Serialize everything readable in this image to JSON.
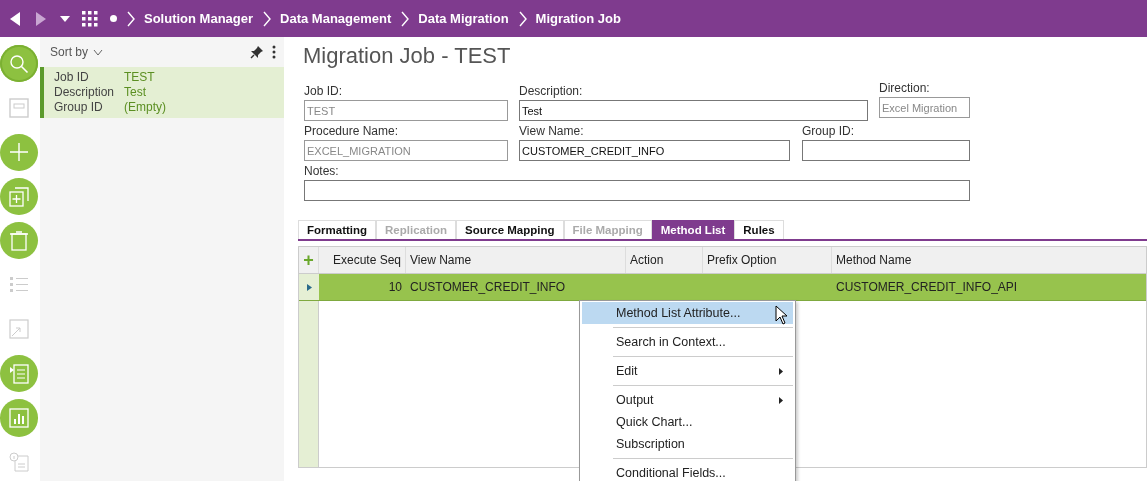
{
  "breadcrumb": [
    "Solution Manager",
    "Data Management",
    "Data Migration",
    "Migration Job"
  ],
  "sidebar": {
    "items": [
      {
        "kind": "search",
        "enabled": true,
        "selected": true
      },
      {
        "kind": "save",
        "enabled": false,
        "selected": false
      },
      {
        "kind": "add",
        "enabled": true,
        "selected": false
      },
      {
        "kind": "duplicate",
        "enabled": true,
        "selected": false
      },
      {
        "kind": "delete",
        "enabled": true,
        "selected": false
      },
      {
        "kind": "list",
        "enabled": false,
        "selected": false
      },
      {
        "kind": "popout",
        "enabled": false,
        "selected": false
      },
      {
        "kind": "details",
        "enabled": true,
        "selected": false
      },
      {
        "kind": "chart",
        "enabled": true,
        "selected": false
      },
      {
        "kind": "info",
        "enabled": false,
        "selected": false
      }
    ]
  },
  "list_panel": {
    "sort_label": "Sort by",
    "records": [
      {
        "selected": true,
        "fields": [
          {
            "label": "Job ID",
            "value": "TEST"
          },
          {
            "label": "Description",
            "value": "Test"
          },
          {
            "label": "Group ID",
            "value": "(Empty)"
          }
        ]
      }
    ]
  },
  "title": "Migration Job - TEST",
  "form": {
    "rows": [
      [
        {
          "label": "Job ID:",
          "value": "TEST",
          "disabled": true
        },
        {
          "label": "Description:",
          "value": "Test",
          "disabled": false
        },
        {
          "label": "Direction:",
          "value": "Excel Migration",
          "disabled": true
        }
      ],
      [
        {
          "label": "Procedure Name:",
          "value": "EXCEL_MIGRATION",
          "disabled": true
        },
        {
          "label": "View Name:",
          "value": "CUSTOMER_CREDIT_INFO",
          "disabled": false
        },
        {
          "label": "Group ID:",
          "disabled": false
        }
      ],
      [
        {
          "label": "Notes:",
          "disabled": false
        }
      ]
    ]
  },
  "tabs": [
    {
      "label": "Formatting",
      "selected": false,
      "disabled": false
    },
    {
      "label": "Replication",
      "selected": false,
      "disabled": true
    },
    {
      "label": "Source Mapping",
      "selected": false,
      "disabled": false
    },
    {
      "label": "File Mapping",
      "selected": false,
      "disabled": true
    },
    {
      "label": "Method List",
      "selected": true,
      "disabled": false
    },
    {
      "label": "Rules",
      "selected": false,
      "disabled": false
    }
  ],
  "table": {
    "add_button": "+",
    "columns": [
      "Execute Seq",
      "View Name",
      "Action",
      "Prefix Option",
      "Method Name"
    ],
    "rows": [
      {
        "selected": true,
        "cells": [
          "10",
          "CUSTOMER_CREDIT_INFO",
          "",
          "",
          "CUSTOMER_CREDIT_INFO_API"
        ]
      }
    ]
  },
  "context_menu": [
    {
      "label": "Method List Attribute...",
      "selected": true,
      "separator_before": false,
      "submenu": false
    },
    {
      "label": "Search in Context...",
      "selected": false,
      "separator_before": true,
      "submenu": false
    },
    {
      "label": "Edit",
      "selected": false,
      "separator_before": true,
      "submenu": true
    },
    {
      "label": "Output",
      "selected": false,
      "separator_before": true,
      "submenu": true
    },
    {
      "label": "Quick Chart...",
      "selected": false,
      "separator_before": false,
      "submenu": false
    },
    {
      "label": "Subscription",
      "selected": false,
      "separator_before": false,
      "submenu": false
    },
    {
      "label": "Conditional Fields...",
      "selected": false,
      "separator_before": true,
      "submenu": false
    }
  ]
}
